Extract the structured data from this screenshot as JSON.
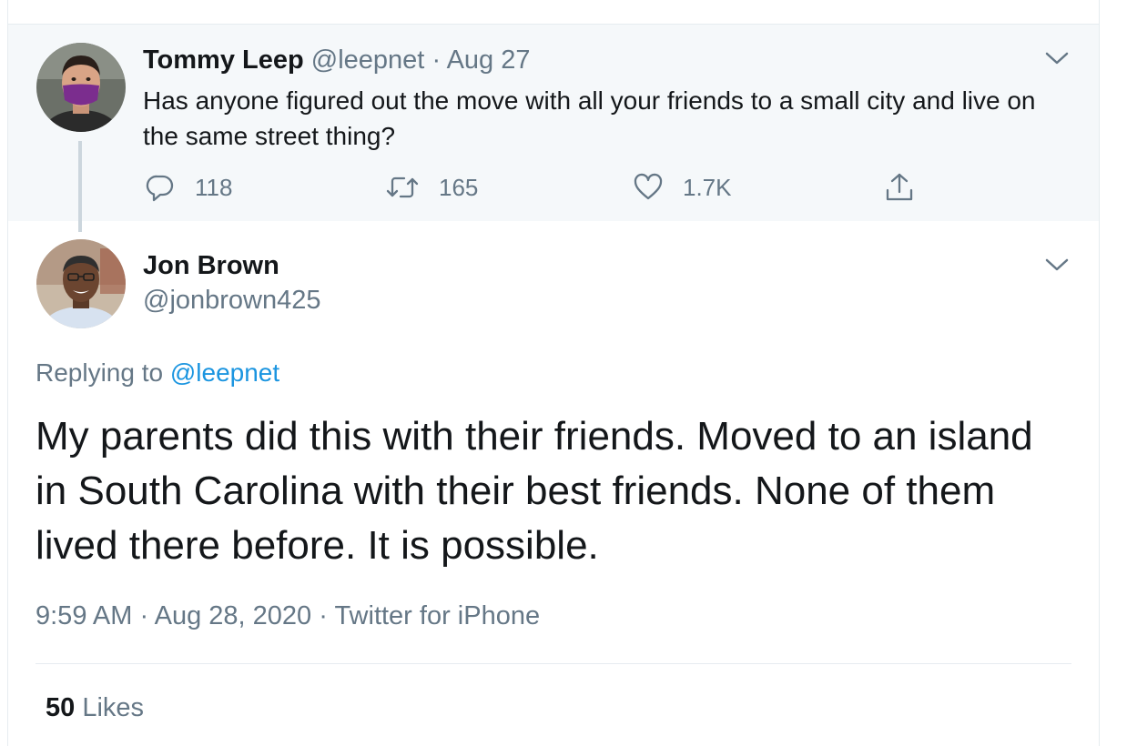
{
  "parent_tweet": {
    "author_name": "Tommy Leep",
    "handle": "@leepnet",
    "separator": "·",
    "date": "Aug 27",
    "text": "Has anyone figured out the move with all your friends to a small city and live on the same street thing?",
    "actions": {
      "reply_count": "118",
      "retweet_count": "165",
      "like_count": "1.7K"
    },
    "icons": [
      "reply-icon",
      "retweet-icon",
      "heart-icon",
      "share-icon",
      "chevron-down-icon"
    ]
  },
  "reply_tweet": {
    "author_name": "Jon Brown",
    "handle": "@jonbrown425",
    "replying_label": "Replying to",
    "replying_handle": "@leepnet",
    "text": "My parents did this with their friends. Moved to an island in South Carolina with their best friends. None of them lived there before. It is possible.",
    "time": "9:59 AM",
    "separator": "·",
    "date": "Aug 28, 2020",
    "source": "Twitter for iPhone",
    "likes_count": "50",
    "likes_label": "Likes"
  },
  "colors": {
    "link": "#1b95e0",
    "muted": "#657786",
    "text": "#14171a",
    "parent_bg": "#f5f8fa",
    "mask": "#7b2d8e"
  }
}
